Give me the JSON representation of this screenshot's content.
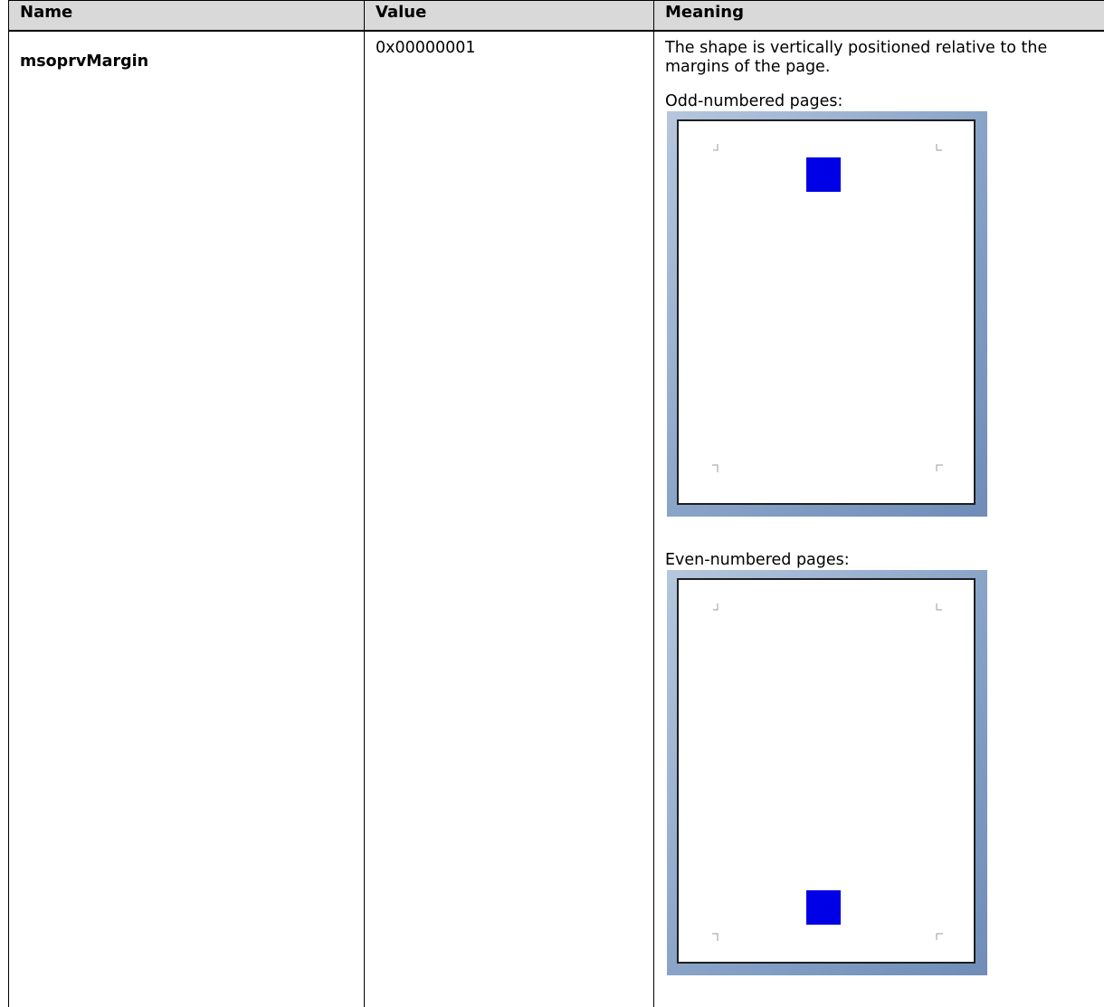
{
  "table": {
    "headers": {
      "name": "Name",
      "value": "Value",
      "meaning": "Meaning"
    },
    "row": {
      "name": "msoprvMargin",
      "value": "0x00000001",
      "meaning": "The shape is vertically positioned relative to the margins of the page.",
      "odd_caption": "Odd-numbered pages:",
      "even_caption": "Even-numbered pages:"
    }
  },
  "illustration": {
    "shape_color": "#0000e6",
    "frame_color": "#8aa4c8",
    "odd_page_shape_position": "top",
    "even_page_shape_position": "bottom"
  }
}
